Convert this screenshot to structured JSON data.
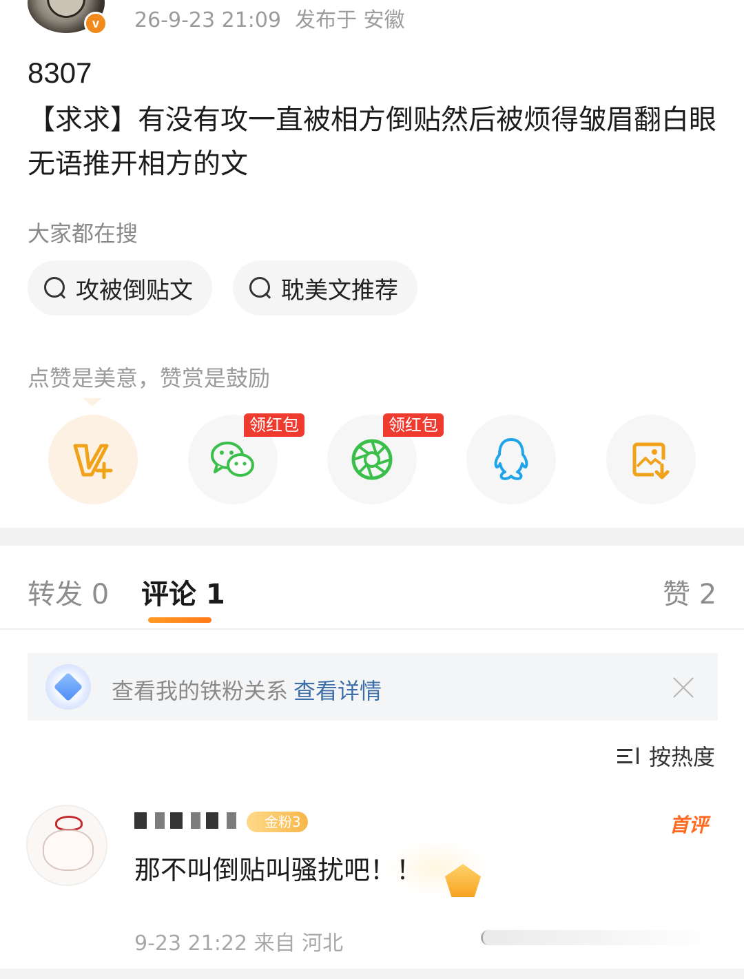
{
  "post": {
    "meta_time": "26-9-23 21:09",
    "meta_location": "发布于 安徽",
    "verified_badge": "v",
    "id_line": "8307",
    "body": "【求求】有没有攻一直被相方倒贴然后被烦得皱眉翻白眼无语推开相方的文"
  },
  "search": {
    "title": "大家都在搜",
    "pills": [
      "攻被倒贴文",
      "耽美文推荐"
    ]
  },
  "share": {
    "tip": "点赞是美意，赞赏是鼓励",
    "items": [
      {
        "icon": "weibo-v-plus-icon",
        "badge": ""
      },
      {
        "icon": "wechat-icon",
        "badge": "领红包"
      },
      {
        "icon": "moments-icon",
        "badge": "领红包"
      },
      {
        "icon": "qq-icon",
        "badge": ""
      },
      {
        "icon": "save-image-icon",
        "badge": ""
      }
    ]
  },
  "tabs": {
    "repost": "转发 0",
    "comments": "评论 1",
    "likes": "赞 2"
  },
  "fan_bar": {
    "text": "查看我的铁粉关系",
    "link": "查看详情"
  },
  "sort": {
    "label": "按热度"
  },
  "comment": {
    "fan_level": "金粉3",
    "first_tag": "首评",
    "text": "那不叫倒贴叫骚扰吧！！",
    "meta": "9-23 21:22 来自 河北"
  },
  "colors": {
    "accent": "#ff8a1e",
    "link": "#3d6ea8",
    "red_badge": "#ef3b2f",
    "wechat_green": "#3bbf4b",
    "qq_blue": "#1fa4ea",
    "save_orange": "#f0a21a"
  }
}
